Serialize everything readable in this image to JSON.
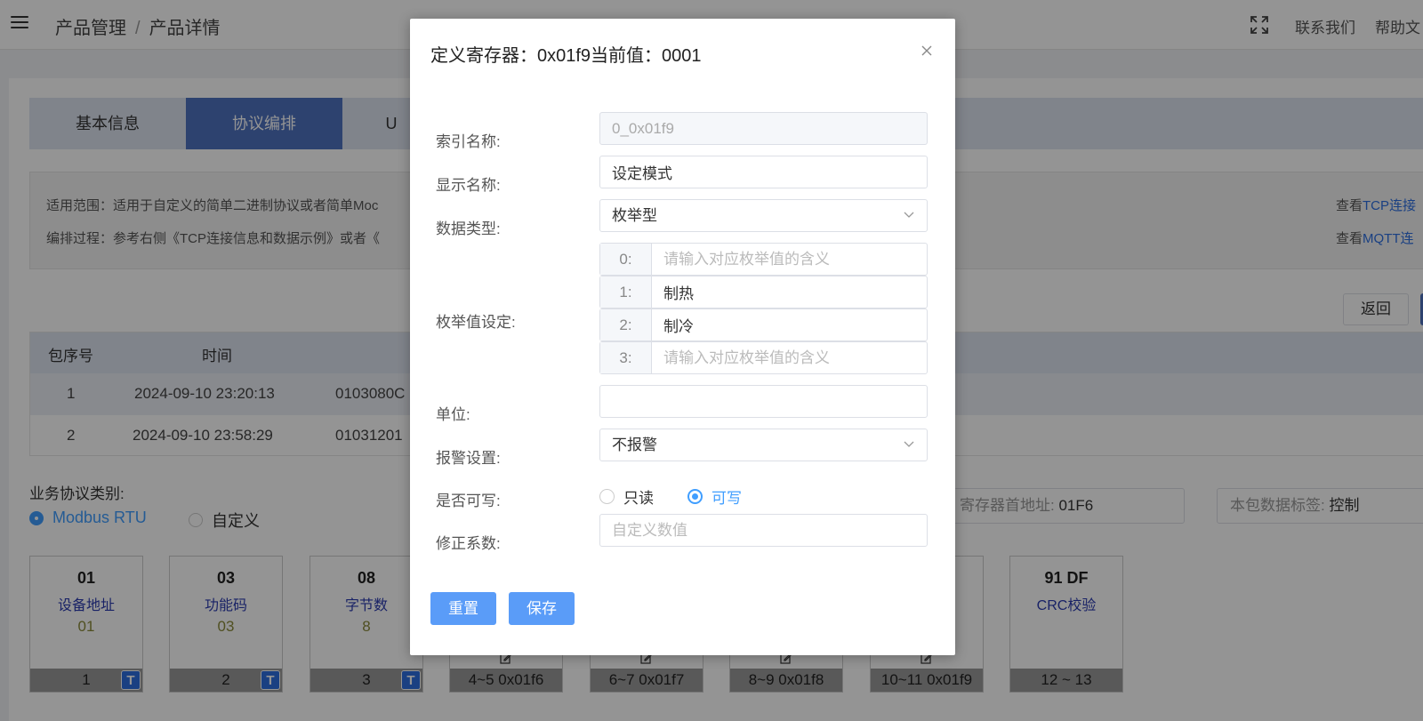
{
  "header": {
    "breadcrumb": [
      "产品管理",
      "产品详情"
    ],
    "breadcrumb_sep": "/",
    "links": [
      "联系我们",
      "帮助文"
    ]
  },
  "tabs": [
    "基本信息",
    "协议编排",
    "U"
  ],
  "notice": {
    "line1": "适用范围：适用于自定义的简单二进制协议或者简单Moc",
    "line2": "编排过程：参考右侧《TCP连接信息和数据示例》或者《",
    "right1_prefix": "查看",
    "right1_link": "TCP连接",
    "right2_prefix": "查看",
    "right2_link": "MQTT连"
  },
  "back_button": "返回",
  "table": {
    "headers": [
      "包序号",
      "时间"
    ],
    "rows": [
      {
        "no": "1",
        "time": "2024-09-10 23:20:13",
        "data": "0103080C"
      },
      {
        "no": "2",
        "time": "2024-09-10 23:58:29",
        "data": "01031201"
      }
    ]
  },
  "business": {
    "label": "业务协议类别:",
    "options": [
      "Modbus RTU",
      "自定义"
    ],
    "selected": "Modbus RTU",
    "register_addr_label": "寄存器首地址:",
    "register_addr_value": "01F6",
    "tag_label": "本包数据标签:",
    "tag_value": "控制"
  },
  "bytes": [
    {
      "hex": "01",
      "name": "设备地址",
      "value": "01",
      "index": "1",
      "badge": "T"
    },
    {
      "hex": "03",
      "name": "功能码",
      "value": "03",
      "index": "2",
      "badge": "T"
    },
    {
      "hex": "08",
      "name": "字节数",
      "value": "8",
      "index": "3",
      "badge": "T"
    },
    {
      "index": "4~5 0x01f6"
    },
    {
      "index": "6~7 0x01f7"
    },
    {
      "index": "8~9 0x01f8"
    },
    {
      "index": "10~11 0x01f9"
    },
    {
      "hex": "91 DF",
      "name": "CRC校验",
      "index": "12 ~ 13"
    }
  ],
  "modal": {
    "title": "定义寄存器：0x01f9当前值：0001",
    "fields": {
      "index_name_label": "索引名称:",
      "index_name_value": "0_0x01f9",
      "display_name_label": "显示名称:",
      "display_name_value": "设定模式",
      "data_type_label": "数据类型:",
      "data_type_value": "枚举型",
      "enum_label": "枚举值设定:",
      "enum_placeholder": "请输入对应枚举值的含义",
      "enums": [
        {
          "key": "0:",
          "value": ""
        },
        {
          "key": "1:",
          "value": "制热"
        },
        {
          "key": "2:",
          "value": "制冷"
        },
        {
          "key": "3:",
          "value": ""
        }
      ],
      "unit_label": "单位:",
      "unit_value": "",
      "alarm_label": "报警设置:",
      "alarm_value": "不报警",
      "writable_label": "是否可写:",
      "writable_options": [
        "只读",
        "可写"
      ],
      "writable_selected": "可写",
      "factor_label": "修正系数:",
      "factor_placeholder": "自定义数值"
    },
    "reset_button": "重置",
    "save_button": "保存"
  }
}
